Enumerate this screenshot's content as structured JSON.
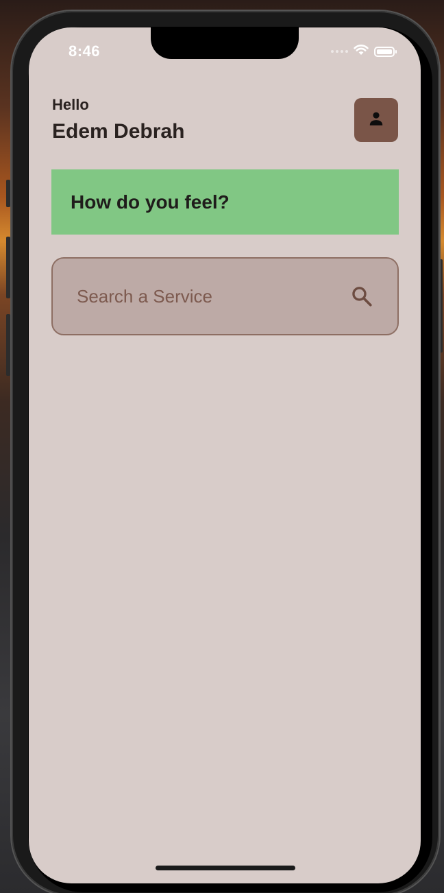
{
  "status_bar": {
    "time": "8:46"
  },
  "header": {
    "greeting": "Hello",
    "user_name": "Edem Debrah"
  },
  "feel_card": {
    "text": "How do you feel?"
  },
  "search": {
    "placeholder": "Search a Service"
  },
  "icons": {
    "profile": "person-icon",
    "search": "search-icon",
    "wifi": "wifi-icon",
    "battery": "battery-icon"
  },
  "colors": {
    "screen_background": "#d8ccc9",
    "profile_button": "#7a5548",
    "feel_card_background": "#81c784",
    "search_background": "#bdaaa6",
    "search_border": "#8d6e63",
    "search_text": "#7d5a4f"
  }
}
